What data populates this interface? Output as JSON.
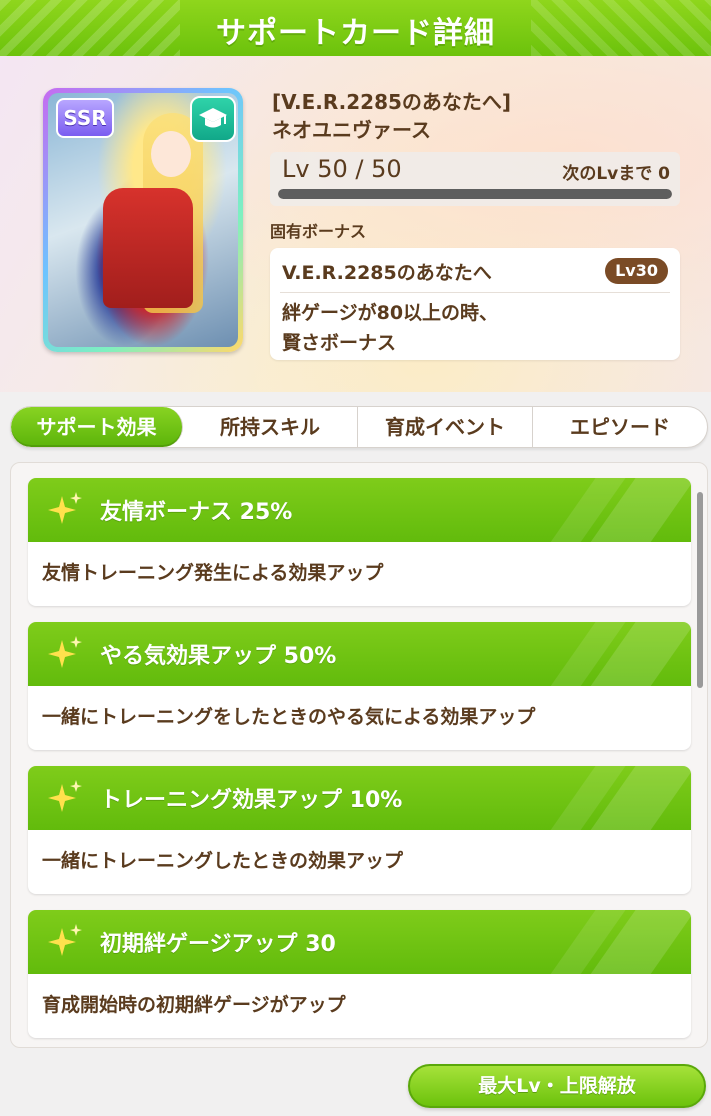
{
  "header": {
    "title": "サポートカード詳細"
  },
  "card": {
    "rarity": "SSR",
    "type_icon": "graduation-cap-icon",
    "title": "[V.E.R.2285のあなたへ]",
    "name": "ネオユニヴァース",
    "level_text": "Lv 50 / 50",
    "next_level_text": "次のLvまで 0",
    "level_progress": 1.0
  },
  "unique_bonus": {
    "heading": "固有ボーナス",
    "name": "V.E.R.2285のあなたへ",
    "level_badge": "Lv30",
    "description_line1": "絆ゲージが80以上の時、",
    "description_line2": "賢さボーナス"
  },
  "tabs": [
    {
      "label": "サポート効果",
      "active": true
    },
    {
      "label": "所持スキル",
      "active": false
    },
    {
      "label": "育成イベント",
      "active": false
    },
    {
      "label": "エピソード",
      "active": false
    }
  ],
  "effects": [
    {
      "title": "友情ボーナス 25%",
      "description": "友情トレーニング発生による効果アップ"
    },
    {
      "title": "やる気効果アップ 50%",
      "description": "一緒にトレーニングをしたときのやる気による効果アップ"
    },
    {
      "title": "トレーニング効果アップ 10%",
      "description": "一緒にトレーニングしたときの効果アップ"
    },
    {
      "title": "初期絆ゲージアップ 30",
      "description": "育成開始時の初期絆ゲージがアップ"
    }
  ],
  "bottom_button": {
    "label": "最大Lv・上限解放"
  },
  "colors": {
    "accent_green": "#6cc20c",
    "text_brown": "#5a3b1e",
    "badge_brown": "#7a4b26",
    "sparkle_yellow": "#ffe14d"
  }
}
